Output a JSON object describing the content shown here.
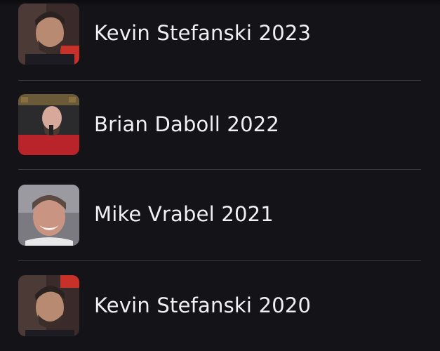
{
  "results": [
    {
      "name": "Kevin Stefanski 2023",
      "image": "coach-portrait"
    },
    {
      "name": "Brian Daboll 2022",
      "image": "coach-portrait"
    },
    {
      "name": "Mike Vrabel 2021",
      "image": "coach-portrait"
    },
    {
      "name": "Kevin Stefanski 2020",
      "image": "coach-portrait"
    }
  ],
  "colors": {
    "background": "#141418",
    "divider": "#3a3a40",
    "text": "#f1f1f3"
  }
}
